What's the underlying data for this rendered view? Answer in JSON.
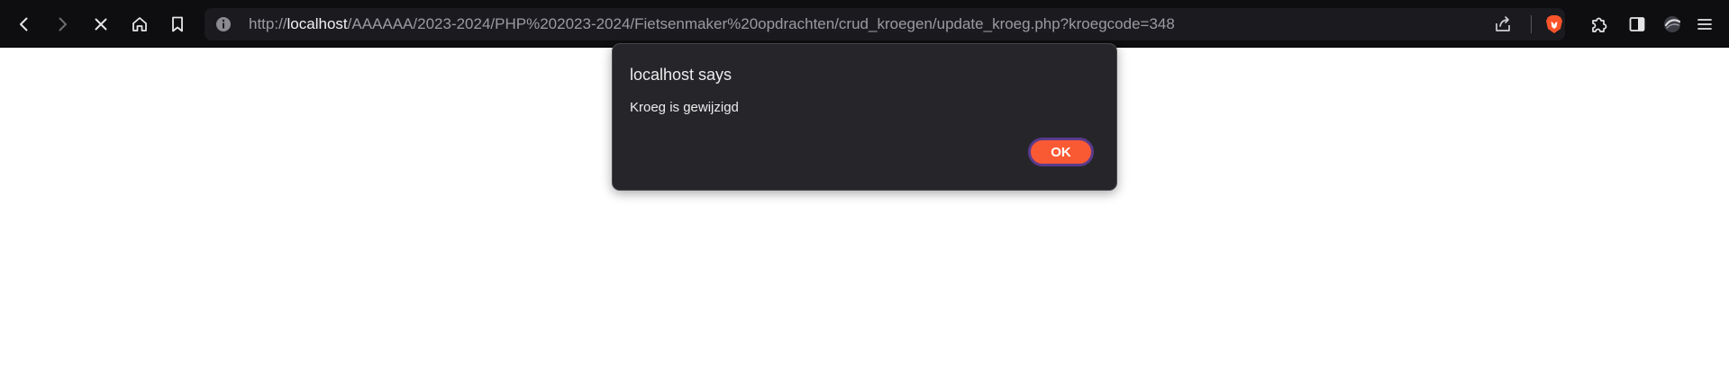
{
  "toolbar": {
    "icons": {
      "back": "chevron-left-icon",
      "forward": "chevron-right-icon",
      "stop": "close-icon",
      "home": "home-icon",
      "bookmark": "bookmark-icon",
      "extensions": "puzzle-icon",
      "sidebar": "sidebar-icon",
      "profile": "profile-icon",
      "menu": "hamburger-menu-icon"
    }
  },
  "url": {
    "prefix": "http://",
    "host": "localhost",
    "path": "/AAAAAA/2023-2024/PHP%202023-2024/Fietsenmaker%20opdrachten/crud_kroegen/update_kroeg.php?kroegcode=348"
  },
  "dialog": {
    "title": "localhost says",
    "message": "Kroeg is gewijzigd",
    "ok_label": "OK"
  },
  "colors": {
    "toolbar_bg": "#0e0e10",
    "urlbar_bg": "#1b1b1f",
    "dialog_bg": "#26262a",
    "accent": "#fa5a33",
    "focus_ring": "#5b3a8c",
    "page_bg": "#ffffff"
  }
}
